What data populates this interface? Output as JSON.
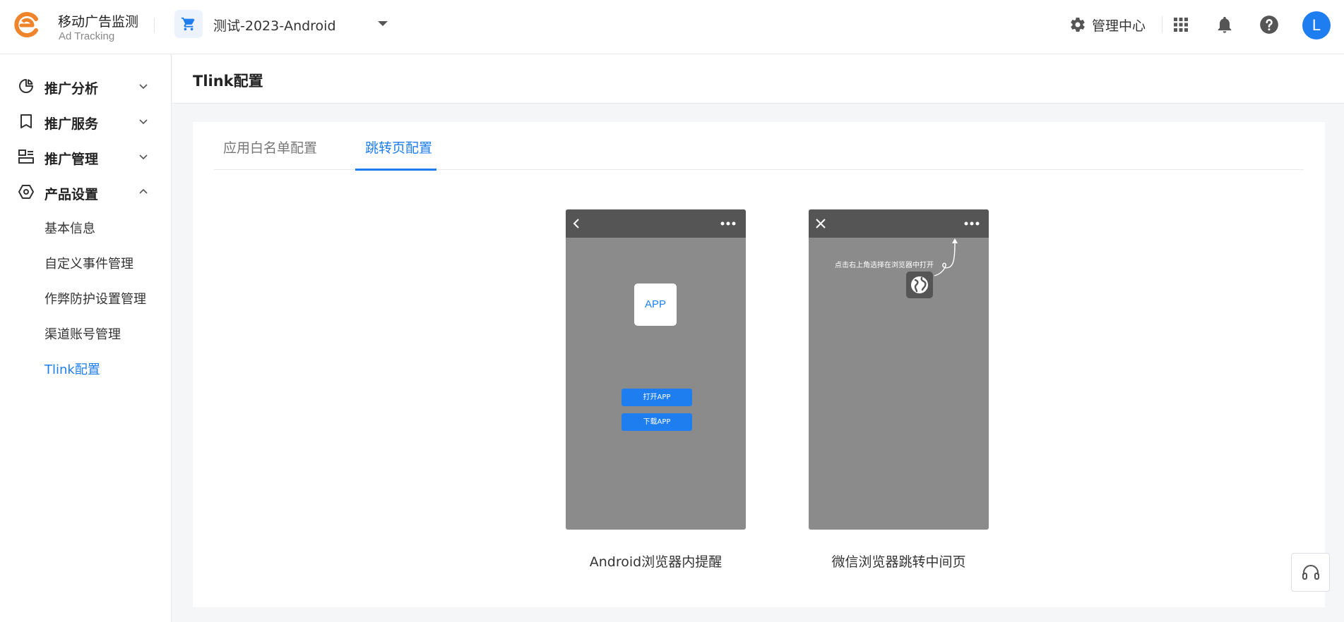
{
  "header": {
    "brand_name": "移动广告监测",
    "brand_sub": "Ad Tracking",
    "app_selector": "测试-2023-Android",
    "admin_center": "管理中心",
    "avatar_letter": "L",
    "accent_color": "#1e7ef0",
    "logo_color": "#f0842a"
  },
  "sidebar": {
    "groups": [
      {
        "label": "推广分析",
        "icon": "analysis-icon",
        "expanded": false
      },
      {
        "label": "推广服务",
        "icon": "bookmark-icon",
        "expanded": false
      },
      {
        "label": "推广管理",
        "icon": "management-icon",
        "expanded": false
      },
      {
        "label": "产品设置",
        "icon": "settings-hex-icon",
        "expanded": true
      }
    ],
    "items": [
      "基本信息",
      "自定义事件管理",
      "作弊防护设置管理",
      "渠道账号管理",
      "Tlink配置"
    ],
    "active_item": "Tlink配置"
  },
  "page": {
    "title": "Tlink配置",
    "tabs": [
      "应用白名单配置",
      "跳转页配置"
    ],
    "active_tab": "跳转页配置"
  },
  "previews": {
    "android": {
      "app_tile": "APP",
      "open_button": "打开APP",
      "download_button": "下载APP",
      "caption": "Android浏览器内提醒"
    },
    "wechat": {
      "hint": "点击右上角选择在浏览器中打开",
      "caption": "微信浏览器跳转中间页"
    }
  }
}
